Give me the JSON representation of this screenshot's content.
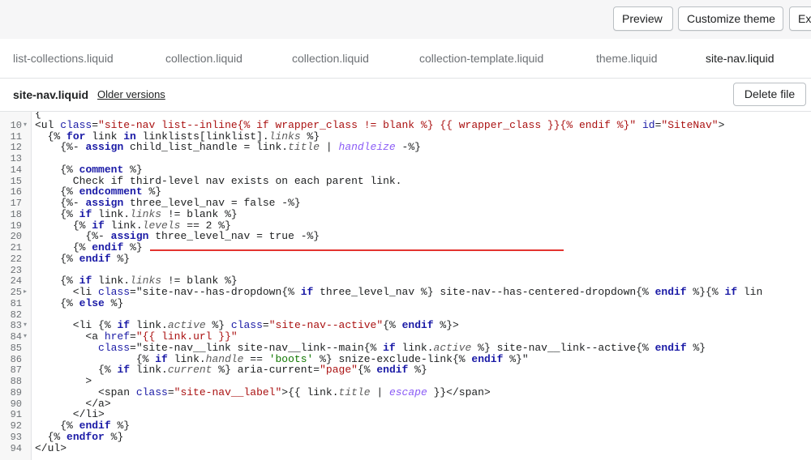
{
  "header": {
    "preview_label": "Preview",
    "customize_label": "Customize theme",
    "exit_label": "Ex"
  },
  "tabs": [
    {
      "label": "list-collections.liquid"
    },
    {
      "label": "collection.liquid"
    },
    {
      "label": "collection.liquid"
    },
    {
      "label": "collection-template.liquid"
    },
    {
      "label": "theme.liquid"
    },
    {
      "label": "site-nav.liquid",
      "active": true,
      "unsaved": true
    }
  ],
  "file": {
    "name": "site-nav.liquid",
    "older_versions_label": "Older versions",
    "delete_label": "Delete file"
  },
  "editor": {
    "lines": [
      {
        "n": "",
        "fold": false,
        "code": "{"
      },
      {
        "n": "10",
        "fold": true,
        "code": "<ul class=\"site-nav list--inline{% if wrapper_class != blank %} {{ wrapper_class }}{% endif %}\" id=\"SiteNav\">"
      },
      {
        "n": "11",
        "fold": false,
        "code": "  {% for link in linklists[linklist].links %}"
      },
      {
        "n": "12",
        "fold": false,
        "code": "    {%- assign child_list_handle = link.title | handleize -%}"
      },
      {
        "n": "13",
        "fold": false,
        "code": ""
      },
      {
        "n": "14",
        "fold": false,
        "code": "    {% comment %}"
      },
      {
        "n": "15",
        "fold": false,
        "code": "      Check if third-level nav exists on each parent link."
      },
      {
        "n": "16",
        "fold": false,
        "code": "    {% endcomment %}"
      },
      {
        "n": "17",
        "fold": false,
        "code": "    {%- assign three_level_nav = false -%}"
      },
      {
        "n": "18",
        "fold": false,
        "code": "    {% if link.links != blank %}"
      },
      {
        "n": "19",
        "fold": false,
        "code": "      {% if link.levels == 2 %}"
      },
      {
        "n": "20",
        "fold": false,
        "code": "        {%- assign three_level_nav = true -%}"
      },
      {
        "n": "21",
        "fold": false,
        "code": "      {% endif %}"
      },
      {
        "n": "22",
        "fold": false,
        "code": "    {% endif %}"
      },
      {
        "n": "23",
        "fold": false,
        "code": ""
      },
      {
        "n": "24",
        "fold": false,
        "code": "    {% if link.links != blank %}"
      },
      {
        "n": "25",
        "fold": "collapsed",
        "code": "      <li class=\"site-nav--has-dropdown{% if three_level_nav %} site-nav--has-centered-dropdown{% endif %}{% if lin"
      },
      {
        "n": "81",
        "fold": false,
        "code": "    {% else %}"
      },
      {
        "n": "82",
        "fold": false,
        "code": ""
      },
      {
        "n": "83",
        "fold": true,
        "code": "      <li {% if link.active %} class=\"site-nav--active\"{% endif %}>"
      },
      {
        "n": "84",
        "fold": true,
        "code": "        <a href=\"{{ link.url }}\""
      },
      {
        "n": "85",
        "fold": false,
        "code": "          class=\"site-nav__link site-nav__link--main{% if link.active %} site-nav__link--active{% endif %}"
      },
      {
        "n": "86",
        "fold": false,
        "code": "                {% if link.handle == 'boots' %} snize-exclude-link{% endif %}\""
      },
      {
        "n": "87",
        "fold": false,
        "code": "          {% if link.current %} aria-current=\"page\"{% endif %}"
      },
      {
        "n": "88",
        "fold": false,
        "code": "        >"
      },
      {
        "n": "89",
        "fold": false,
        "code": "          <span class=\"site-nav__label\">{{ link.title | escape }}</span>"
      },
      {
        "n": "90",
        "fold": false,
        "code": "        </a>"
      },
      {
        "n": "91",
        "fold": false,
        "code": "      </li>"
      },
      {
        "n": "92",
        "fold": false,
        "code": "    {% endif %}"
      },
      {
        "n": "93",
        "fold": false,
        "code": "  {% endfor %}"
      },
      {
        "n": "94",
        "fold": false,
        "code": "</ul>"
      }
    ]
  }
}
